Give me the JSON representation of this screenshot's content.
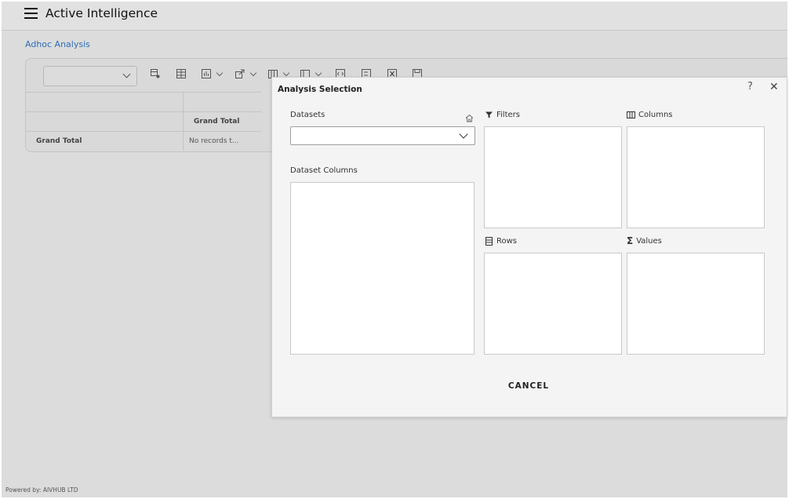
{
  "app": {
    "title": "Active Intelligence",
    "breadcrumb": "Adhoc Analysis",
    "footer": "Powered by: AIVHUB LTD"
  },
  "toolbar": {
    "select_value": "",
    "icons": [
      "table-settings-icon",
      "table-icon",
      "chart-icon",
      "export-icon",
      "layout-icon",
      "layout-alt-icon",
      "code-icon",
      "formula-icon",
      "excel-icon",
      "save-icon"
    ]
  },
  "grid": {
    "column_header": "Grand Total",
    "row_header": "Grand Total",
    "cell_value": "No records t..."
  },
  "dialog": {
    "title": "Analysis Selection",
    "help_label": "?",
    "close_label": "✕",
    "datasets_label": "Datasets",
    "datasets_value": "",
    "dataset_columns_label": "Dataset Columns",
    "filters_label": "Filters",
    "columns_label": "Columns",
    "rows_label": "Rows",
    "values_label": "Values",
    "cancel_label": "CANCEL"
  },
  "colors": {
    "link": "#2f6db4",
    "backdrop": "#dcdcdc",
    "dialog_bg": "#f4f4f4"
  }
}
